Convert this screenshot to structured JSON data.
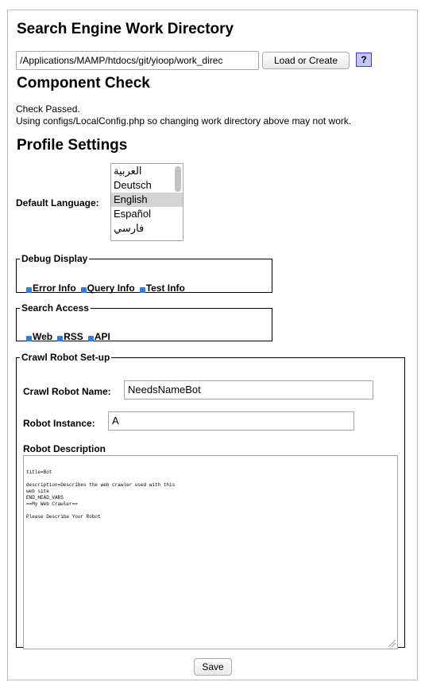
{
  "headings": {
    "work_directory": "Search Engine Work Directory",
    "component_check": "Component Check",
    "profile_settings": "Profile Settings"
  },
  "work_directory": {
    "value": "/Applications/MAMP/htdocs/git/yioop/work_direc",
    "load_button": "Load or Create",
    "help_button": "?"
  },
  "component_check": {
    "line1": "Check Passed.",
    "line2": "Using configs/LocalConfig.php so changing work directory above may not work."
  },
  "profile": {
    "default_language_label": "Default Language:",
    "languages": [
      "العربية",
      "Deutsch",
      "English",
      "Español",
      "فارسي"
    ],
    "selected_language": "English"
  },
  "debug_display": {
    "legend": "Debug Display",
    "options": [
      {
        "label": "Error Info",
        "checked": true
      },
      {
        "label": "Query Info",
        "checked": true
      },
      {
        "label": "Test Info",
        "checked": true
      }
    ]
  },
  "search_access": {
    "legend": "Search Access",
    "options": [
      {
        "label": "Web",
        "checked": true
      },
      {
        "label": "RSS",
        "checked": true
      },
      {
        "label": "API",
        "checked": true
      }
    ]
  },
  "crawl_robot": {
    "legend": "Crawl Robot Set-up",
    "name_label": "Crawl Robot Name:",
    "name_value": "NeedsNameBot",
    "instance_label": "Robot Instance:",
    "instance_value": "A",
    "description_label": "Robot Description",
    "description_text": "title=Bot\n\ndescription=Describes the web crawler used with this\nweb site\nEND_HEAD_VARS\n==My Web Crawler==\n\nPlease Describe Your Robot"
  },
  "save_button": "Save",
  "colors": {
    "checkbox_accent": "#2e7ce5",
    "help_bg": "#c6c7f6",
    "selected_option_bg": "#d4d4d4"
  }
}
